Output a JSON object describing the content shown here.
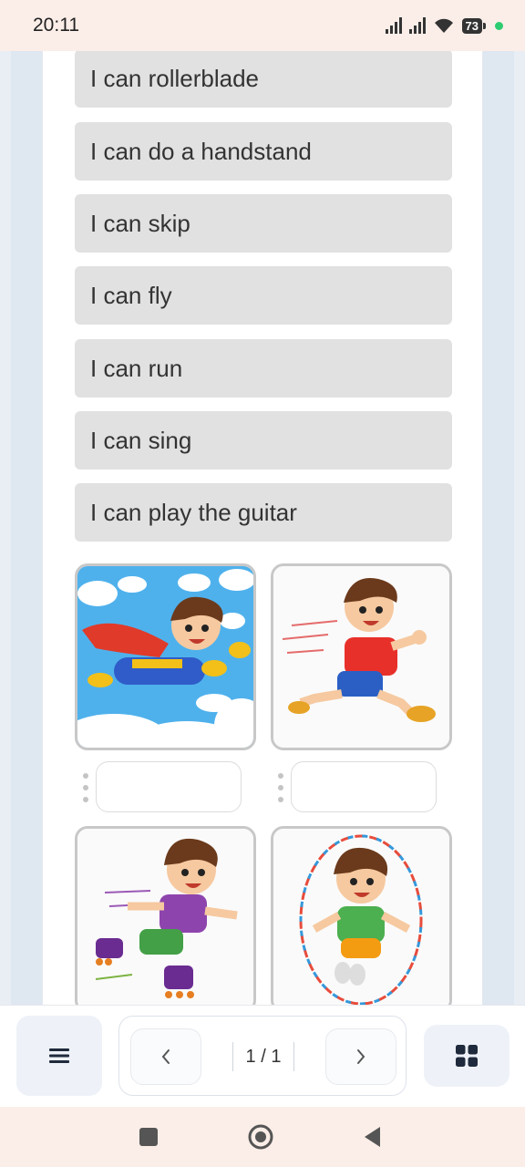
{
  "status": {
    "time": "20:11",
    "battery": "73"
  },
  "options": [
    {
      "label": "I can rollerblade"
    },
    {
      "label": "I can do a handstand"
    },
    {
      "label": "I can skip"
    },
    {
      "label": "I can fly"
    },
    {
      "label": "I can run"
    },
    {
      "label": "I can sing"
    },
    {
      "label": "I can play the guitar"
    }
  ],
  "images": [
    {
      "icon": "superhero-flying-boy"
    },
    {
      "icon": "running-boy"
    },
    {
      "icon": "rollerblading-boy"
    },
    {
      "icon": "skipping-rope-boy"
    }
  ],
  "pager": {
    "indicator": "1 / 1"
  },
  "colors": {
    "accent": "#1f2a3c",
    "option_bg": "#e1e1e1",
    "status_bg": "#fbeee8"
  }
}
